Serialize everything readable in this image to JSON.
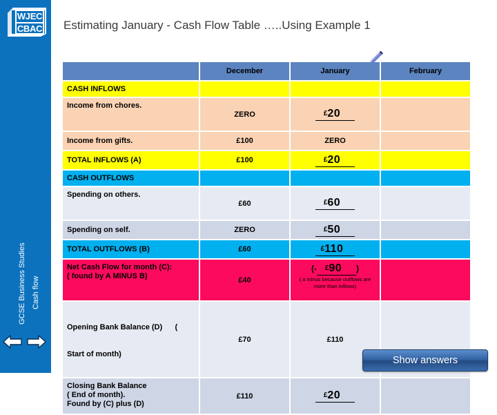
{
  "sidebar": {
    "logo": {
      "line1": "WJEC",
      "line2": "CBAC"
    },
    "course_label": "GCSE Business Studies",
    "topic_label": "Cash flow",
    "prev_icon": "left-arrow-icon",
    "next_icon": "right-arrow-icon"
  },
  "title": "Estimating January - Cash Flow Table …..Using Example 1",
  "pencil_icon": "pencil-icon",
  "table": {
    "columns": [
      "",
      "December",
      "January",
      "February"
    ],
    "rows": [
      {
        "label": "CASH INFLOWS",
        "december": "",
        "january": "",
        "february": ""
      },
      {
        "label": "Income from chores.",
        "december": "ZERO",
        "january_answer": "20",
        "february": ""
      },
      {
        "label": "Income from gifts.",
        "december": "£100",
        "january": "ZERO",
        "february": ""
      },
      {
        "label": "TOTAL INFLOWS (A)",
        "december": "£100",
        "january_answer": "20",
        "february": ""
      },
      {
        "label": "CASH OUTFLOWS",
        "december": "",
        "january": "",
        "february": ""
      },
      {
        "label": "Spending on others.",
        "december": "£60",
        "january_answer": "60",
        "february": ""
      },
      {
        "label": "Spending on self.",
        "december": "ZERO",
        "january_answer": "50",
        "february": ""
      },
      {
        "label": "TOTAL OUTFLOWS (B)",
        "december": "£60",
        "january_answer": "110",
        "february": ""
      },
      {
        "label_line1": "Net Cash Flow for month (C):",
        "label_line2": "( found by  A MINUS B)",
        "december": "£40",
        "january_answer": "90",
        "january_note": "( a minus because outflows are more than inflows)",
        "february": ""
      },
      {
        "label_line1": "Opening Bank Balance (D)      (",
        "label_line2": "Start of month)",
        "december": "£70",
        "january": "£110",
        "february": ""
      },
      {
        "label_line1": "Closing Bank Balance",
        "label_line2": "( End of month).",
        "label_line3": "Found by (C) plus (D)",
        "december": "£110",
        "january_answer": "20",
        "february": ""
      }
    ],
    "currency_symbol": "£",
    "minus_prefix": "(-",
    "minus_suffix": ")"
  },
  "show_answers_button": "Show answers",
  "colors": {
    "sidebar_blue": "#0c72be",
    "header_blue": "#5c84c0",
    "yellow": "#ffff00",
    "peach": "#fad3b4",
    "cyan": "#00b0ef",
    "gray_light": "#e6eaf2",
    "gray_dark": "#ced5e5",
    "pink": "#fc0a5d",
    "button_blue": "#2f5f9e"
  }
}
